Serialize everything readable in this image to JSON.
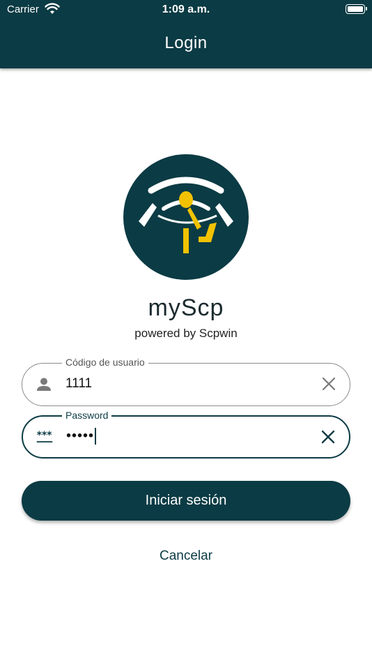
{
  "status_bar": {
    "carrier": "Carrier",
    "time": "1:09 a.m."
  },
  "nav": {
    "title": "Login"
  },
  "app": {
    "name": "myScp",
    "powered_by": "powered by Scpwin"
  },
  "form": {
    "username": {
      "label": "Código de usuario",
      "value": "1111",
      "icon": "person-icon"
    },
    "password": {
      "label": "Password",
      "value": "•••••",
      "icon": "password-icon"
    }
  },
  "actions": {
    "login_label": "Iniciar sesión",
    "cancel_label": "Cancelar"
  },
  "colors": {
    "primary": "#0b3b44",
    "accent": "#f2c200",
    "background": "#ffffff"
  }
}
